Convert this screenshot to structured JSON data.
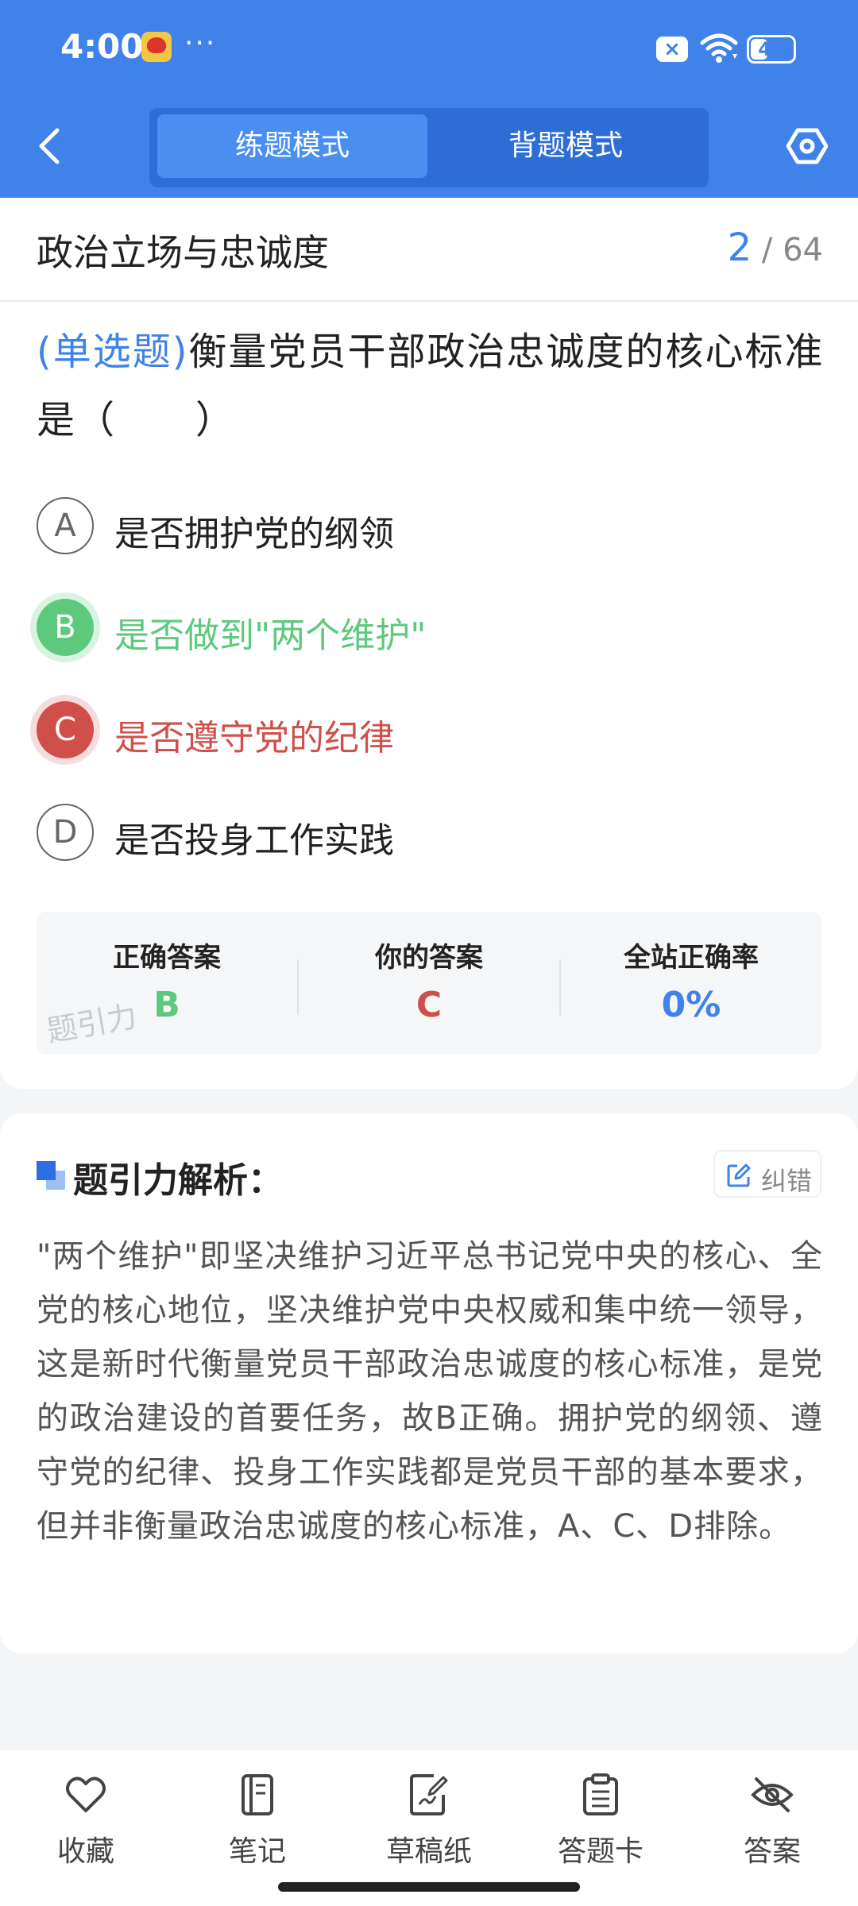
{
  "status_bar": {
    "time": "4:00",
    "dots": "···",
    "battery_text": "40",
    "battery_level": 0.4
  },
  "header": {
    "tabs": [
      {
        "label": "练题模式",
        "active": true
      },
      {
        "label": "背题模式",
        "active": false
      }
    ]
  },
  "section": {
    "title": "政治立场与忠诚度",
    "current": "2",
    "total": "/ 64"
  },
  "question": {
    "type": "(单选题)",
    "text": "衡量党员干部政治忠诚度的核心标准是（　　）"
  },
  "options": [
    {
      "key": "A",
      "text": "是否拥护党的纲领",
      "state": "normal"
    },
    {
      "key": "B",
      "text": "是否做到\"两个维护\"",
      "state": "correct"
    },
    {
      "key": "C",
      "text": "是否遵守党的纪律",
      "state": "wrong"
    },
    {
      "key": "D",
      "text": "是否投身工作实践",
      "state": "normal"
    }
  ],
  "answer_summary": {
    "correct_label": "正确答案",
    "correct_value": "B",
    "yours_label": "你的答案",
    "yours_value": "C",
    "rate_label": "全站正确率",
    "rate_value": "0%",
    "watermark": "题引力"
  },
  "analysis": {
    "title": "题引力解析：",
    "report_label": "纠错",
    "text": "\"两个维护\"即坚决维护习近平总书记党中央的核心、全党的核心地位，坚决维护党中央权威和集中统一领导，这是新时代衡量党员干部政治忠诚度的核心标准，是党的政治建设的首要任务，故B正确。拥护党的纲领、遵守党的纪律、投身工作实践都是党员干部的基本要求，但并非衡量政治忠诚度的核心标准，A、C、D排除。"
  },
  "bottom_nav": [
    {
      "label": "收藏",
      "icon": "heart-icon"
    },
    {
      "label": "笔记",
      "icon": "notebook-icon"
    },
    {
      "label": "草稿纸",
      "icon": "draft-paper-icon"
    },
    {
      "label": "答题卡",
      "icon": "answer-card-icon"
    },
    {
      "label": "答案",
      "icon": "eye-off-icon"
    }
  ],
  "colors": {
    "primary": "#3f82ea",
    "correct": "#5cc97d",
    "wrong": "#d04f4a"
  }
}
